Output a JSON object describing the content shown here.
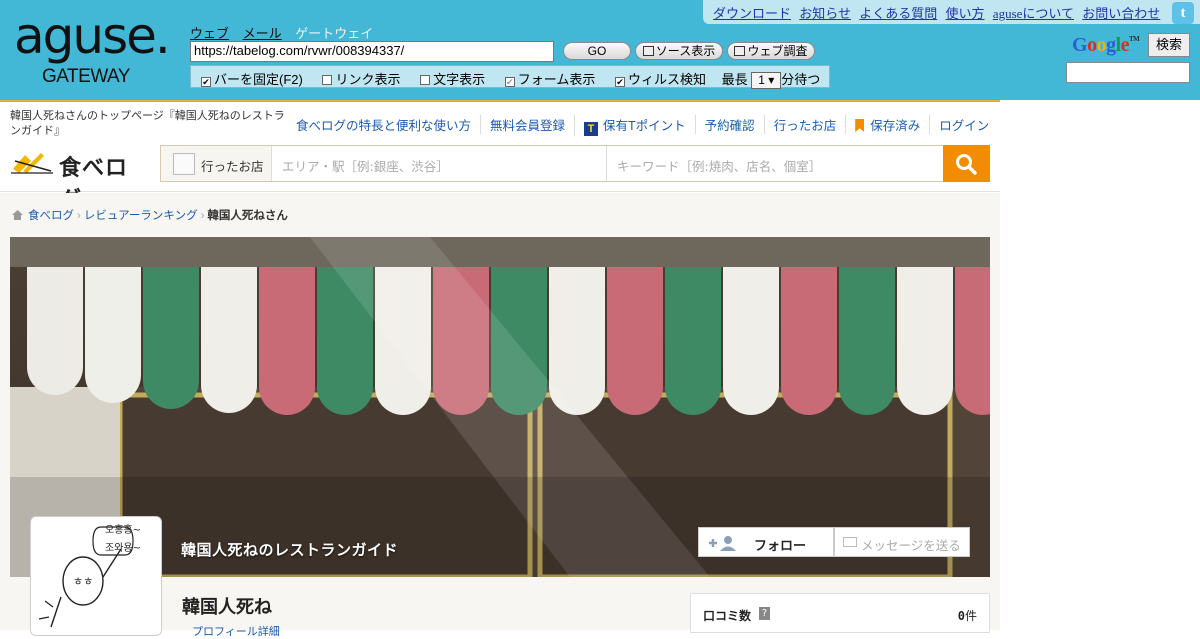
{
  "aguse": {
    "logo_main": "aguse.",
    "logo_sub": "GATEWAY",
    "tabs": [
      "ウェブ",
      "メール",
      "ゲートウェイ"
    ],
    "url_value": "https://tabelog.com/rvwr/008394337/",
    "go_label": "GO",
    "source_label": "ソース表示",
    "web_check_label": "ウェブ調査",
    "options": {
      "fix_bar": "バーを固定(F2)",
      "link_display": "リンク表示",
      "text_display": "文字表示",
      "form_display": "フォーム表示",
      "virus_check": "ウィルス検知",
      "max_wait_prefix": "最長",
      "max_wait_value": "1",
      "max_wait_suffix": "分待つ"
    },
    "top_links": [
      "ダウンロード",
      "お知らせ",
      "よくある質問",
      "使い方",
      "aguseについて",
      "お問い合わせ"
    ],
    "google_logo": "Google",
    "google_tm": "TM",
    "google_search_label": "検索",
    "brand_color": "#42b7d6"
  },
  "tabelog": {
    "site_title": "韓国人死ねさんのトップページ『韓国人死ねのレストランガイド』",
    "nav": [
      "食べログの特長と便利な使い方",
      "無料会員登録",
      "保有Tポイント",
      "予約確認",
      "行ったお店",
      "保存済み",
      "ログイン"
    ],
    "logo_text": "食べログ",
    "search": {
      "went_label": "行ったお店",
      "area_placeholder": "エリア・駅［例:銀座、渋谷］",
      "keyword_placeholder": "キーワード［例:焼肉、店名、個室］"
    },
    "breadcrumb": [
      "食べログ",
      "レビュアーランキング",
      "韓国人死ねさん"
    ],
    "cover_title": "韓国人死ねのレストランガイド",
    "follow_label": "フォロー",
    "message_label": "メッセージを送る",
    "user_name": "韓国人死ね",
    "profile_link": "プロフィール詳細",
    "stats": {
      "label": "口コミ数",
      "help": "?",
      "value": "0",
      "unit": "件"
    },
    "avatar_text": [
      "오홍홍~",
      "조와용~"
    ],
    "accent_color": "#f28c00"
  }
}
